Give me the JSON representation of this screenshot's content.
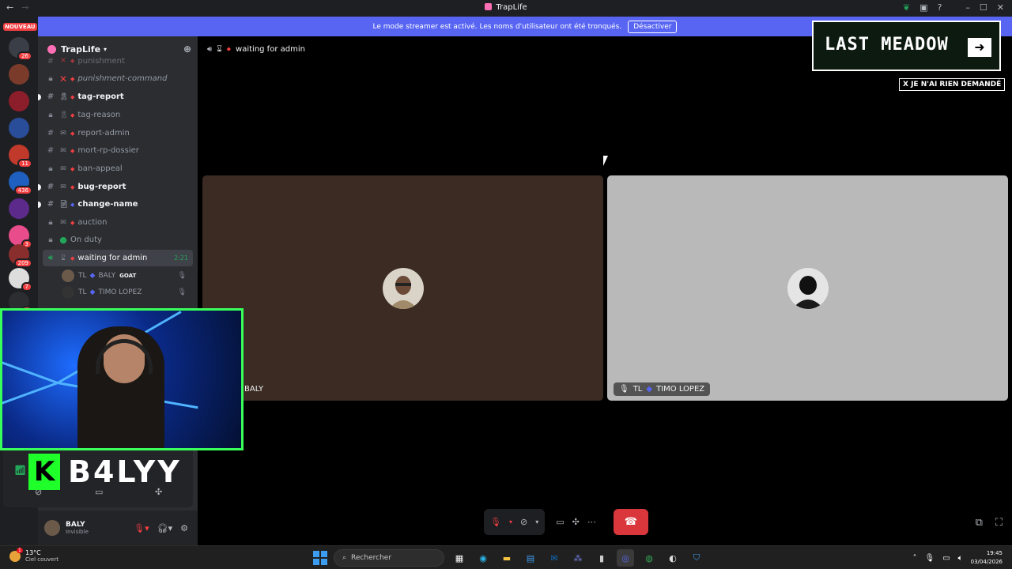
{
  "window": {
    "title": "TrapLife"
  },
  "banner": {
    "message": "Le mode streamer est activé. Les noms d'utilisateur ont été tronqués.",
    "button": "Désactiver"
  },
  "servers": {
    "new_label": "NOUVEAU",
    "badges": [
      "26",
      "11",
      "436",
      "3",
      "209",
      "7",
      "2"
    ]
  },
  "guild": {
    "name": "TrapLife"
  },
  "channels": [
    {
      "name": "punishment"
    },
    {
      "name": "punishment-command"
    },
    {
      "name": "tag-report"
    },
    {
      "name": "tag-reason"
    },
    {
      "name": "report-admin"
    },
    {
      "name": "mort-rp-dossier"
    },
    {
      "name": "ban-appeal"
    },
    {
      "name": "bug-report"
    },
    {
      "name": "change-name"
    },
    {
      "name": "auction"
    },
    {
      "name": "On duty"
    },
    {
      "name": "waiting for admin",
      "time": "2:21"
    }
  ],
  "voice_members": [
    {
      "tag": "TL",
      "name": "BALY",
      "badge": "GOAT"
    },
    {
      "tag": "TL",
      "name": "TIMO LOPEZ"
    }
  ],
  "user": {
    "name": "BALY",
    "status": "Invisible"
  },
  "header": {
    "channel": "waiting for admin"
  },
  "tiles": {
    "left": {
      "name": "BALY"
    },
    "right": {
      "tag": "TL",
      "name": "TIMO LOPEZ"
    }
  },
  "overlay": {
    "brand": "LAST MEADOW",
    "note": "X JE N'AI RIEN DEMANDÉ",
    "logo_text": "B4LYY",
    "logo_letter": "K"
  },
  "taskbar": {
    "weather_temp": "13°C",
    "weather_desc": "Ciel couvert",
    "weather_badge": "1",
    "search_placeholder": "Rechercher",
    "time": "19:45",
    "date": "03/04/2026"
  },
  "colors": {
    "accent": "#5865f2",
    "hangup": "#da373c",
    "online": "#23a55a",
    "webcam_border": "#39ff5a"
  }
}
